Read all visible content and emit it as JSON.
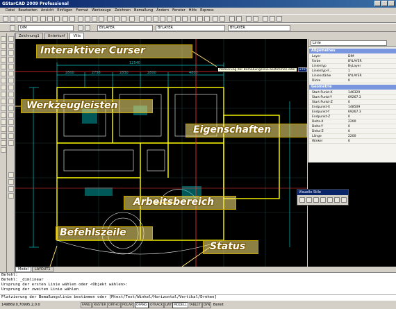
{
  "window": {
    "title": "GStarCAD 2009 Professional"
  },
  "menu": [
    "Datei",
    "Bearbeiten",
    "Ansicht",
    "Einfügen",
    "Format",
    "Werkzeuge",
    "Zeichnen",
    "Bemaßung",
    "Ändern",
    "Fenster",
    "Hilfe",
    "Express"
  ],
  "toolbar": {
    "layer_combo": "DIM",
    "color_combo": "BYLAYER",
    "linetype_combo": "BYLAYER",
    "lineweight_combo": "BYLAYER"
  },
  "doc_tabs": [
    "Zeichnung1",
    "Unterkunf",
    "Villa"
  ],
  "layout_tabs": [
    "Model",
    "LAYOUT1"
  ],
  "properties": {
    "selected_type": "Linie",
    "sections": [
      {
        "title": "Allgemeines",
        "rows": [
          {
            "key": "Layer",
            "value": "DIM"
          },
          {
            "key": "Farbe",
            "value": "BYLAYER"
          },
          {
            "key": "Linientyp",
            "value": "ByLayer"
          },
          {
            "key": "Linientyp-F...",
            "value": "1"
          },
          {
            "key": "Linienstärke",
            "value": "BYLAYER"
          },
          {
            "key": "Dicke",
            "value": "0"
          }
        ]
      },
      {
        "title": "Geometrie",
        "rows": [
          {
            "key": "Start Punkt-X",
            "value": "146329"
          },
          {
            "key": "Start Punkt-Y",
            "value": "69267.3"
          },
          {
            "key": "Start Punkt-Z",
            "value": "0"
          },
          {
            "key": "Endpunkt-X",
            "value": "148509"
          },
          {
            "key": "Endpunkt-Y",
            "value": "69267.3"
          },
          {
            "key": "Endpunkt-Z",
            "value": "0"
          },
          {
            "key": "Delta-X",
            "value": "2200"
          },
          {
            "key": "Delta-Y",
            "value": "0"
          },
          {
            "key": "Delta-Z",
            "value": "0"
          },
          {
            "key": "Länge",
            "value": "2200"
          },
          {
            "key": "Winkel",
            "value": "0"
          }
        ]
      }
    ]
  },
  "visual_style_toolbar": {
    "title": "Visuelle Stile"
  },
  "cursor_tooltip": {
    "prompt": "Platzierung der Bemaßungslinie bestimmen oder",
    "input_value": "22741",
    "angle_value": "270°",
    "label": "Stab"
  },
  "drawing_dimensions": [
    "12540",
    "2800",
    "2756",
    "2830",
    "2800",
    "4800",
    "3470",
    "2250",
    "1140",
    "2870",
    "1400",
    "3200",
    "1740"
  ],
  "command_lines": [
    "Befehl:",
    "Befehl: _dimlinear",
    "Ursprung der ersten Linie wählen oder <Objekt wählen>:",
    "Ursprung der zweiten Linie wählen",
    "Platzierung der Bemaßungslinie bestimmen oder [Mtext/Text/Winkel/Horizontal/Vertikal/Drehen]"
  ],
  "status": {
    "coords": "149869.0,70995.2,0.0",
    "buttons": [
      "FANG",
      "RASTER",
      "ORTHO",
      "POLAR",
      "OFANG",
      "OTRACK",
      "LWT",
      "MODELL",
      "TABLET",
      "DYN"
    ],
    "active": [
      "OFANG",
      "MODELL"
    ],
    "ready": "Bereit"
  },
  "annotations": [
    {
      "text": "Interaktiver Curser"
    },
    {
      "text": "Werkzeugleisten"
    },
    {
      "text": "Eigenschaften"
    },
    {
      "text": "Arbeitsbereich"
    },
    {
      "text": "Befehlszeile"
    },
    {
      "text": "Status"
    }
  ],
  "colors": {
    "accent_titlebar": "#0a246a",
    "callout_fill": "#ffe17a",
    "drawing_bg": "#000000",
    "dim_line": "#00c8c8",
    "wall": "#ffff00"
  }
}
